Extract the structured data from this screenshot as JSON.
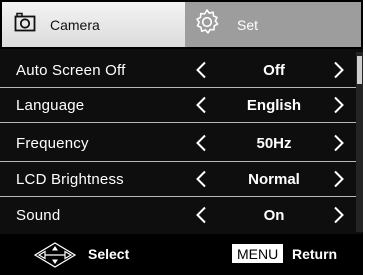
{
  "tabs": [
    {
      "label": "Camera",
      "icon": "camera-icon",
      "active": true
    },
    {
      "label": "Set",
      "icon": "gear-icon",
      "active": false
    }
  ],
  "menu": {
    "items": [
      {
        "label": "Auto Screen Off",
        "value": "Off"
      },
      {
        "label": "Language",
        "value": "English"
      },
      {
        "label": "Frequency",
        "value": "50Hz"
      },
      {
        "label": "LCD Brightness",
        "value": "Normal"
      },
      {
        "label": "Sound",
        "value": "On"
      }
    ]
  },
  "footer": {
    "select_label": "Select",
    "menu_key": "MENU",
    "return_label": "Return"
  },
  "colors": {
    "background": "#0e0e0e",
    "active_tab": "#e8e8e8",
    "inactive_tab": "#9d9d9d",
    "separator": "#b8b8b8"
  }
}
